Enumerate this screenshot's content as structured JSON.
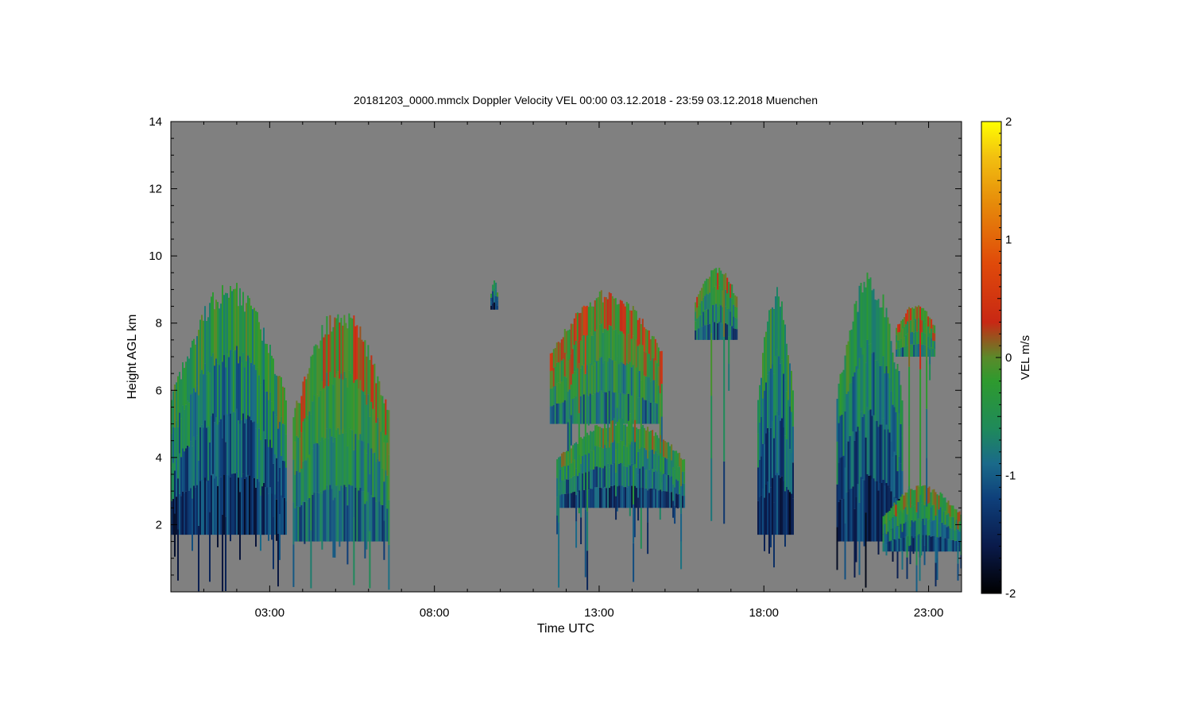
{
  "chart_data": {
    "type": "heatmap",
    "title": "20181203_0000.mmclx Doppler Velocity VEL   00:00 03.12.2018 - 23:59 03.12.2018 Muenchen",
    "xlabel": "Time UTC",
    "ylabel": "Height AGL km",
    "xlim": [
      0,
      24
    ],
    "ylim": [
      0,
      14
    ],
    "x_ticks": [
      {
        "value": 3,
        "label": "03:00"
      },
      {
        "value": 8,
        "label": "08:00"
      },
      {
        "value": 13,
        "label": "13:00"
      },
      {
        "value": 18,
        "label": "18:00"
      },
      {
        "value": 23,
        "label": "23:00"
      }
    ],
    "y_ticks": [
      {
        "value": 2,
        "label": "2"
      },
      {
        "value": 4,
        "label": "4"
      },
      {
        "value": 6,
        "label": "6"
      },
      {
        "value": 8,
        "label": "8"
      },
      {
        "value": 10,
        "label": "10"
      },
      {
        "value": 12,
        "label": "12"
      },
      {
        "value": 14,
        "label": "14"
      }
    ],
    "background_color": "#808080",
    "colorbar": {
      "label": "VEL m/s",
      "range": [
        -2,
        2
      ],
      "ticks": [
        {
          "value": 2,
          "label": "2"
        },
        {
          "value": 1,
          "label": "1"
        },
        {
          "value": 0,
          "label": "0"
        },
        {
          "value": -1,
          "label": "-1"
        },
        {
          "value": -2,
          "label": "-2"
        }
      ],
      "colormap": [
        {
          "value": -2.0,
          "color": "#000000"
        },
        {
          "value": -1.6,
          "color": "#0a1a4a"
        },
        {
          "value": -1.2,
          "color": "#0e3f7a"
        },
        {
          "value": -0.9,
          "color": "#1a6a8a"
        },
        {
          "value": -0.6,
          "color": "#1f8a5a"
        },
        {
          "value": -0.2,
          "color": "#2e9a2e"
        },
        {
          "value": 0.0,
          "color": "#5a8a2a"
        },
        {
          "value": 0.3,
          "color": "#c82814"
        },
        {
          "value": 0.8,
          "color": "#e04a0a"
        },
        {
          "value": 1.3,
          "color": "#e68a0a"
        },
        {
          "value": 1.7,
          "color": "#f2c010"
        },
        {
          "value": 2.0,
          "color": "#ffff00"
        }
      ]
    },
    "cloud_regions": [
      {
        "t_start": 0.0,
        "t_end": 3.5,
        "base_km": 1.7,
        "top_km": 9.3,
        "mean_vel": -0.8
      },
      {
        "t_start": 3.7,
        "t_end": 6.6,
        "base_km": 1.5,
        "top_km": 8.6,
        "mean_vel": -0.4
      },
      {
        "t_start": 9.7,
        "t_end": 9.9,
        "base_km": 8.4,
        "top_km": 9.3,
        "mean_vel": -0.9
      },
      {
        "t_start": 11.5,
        "t_end": 14.9,
        "base_km": 5.0,
        "top_km": 9.0,
        "mean_vel": -0.3
      },
      {
        "t_start": 11.7,
        "t_end": 15.6,
        "base_km": 2.5,
        "top_km": 5.2,
        "mean_vel": -0.7
      },
      {
        "t_start": 15.9,
        "t_end": 17.2,
        "base_km": 7.5,
        "top_km": 9.7,
        "mean_vel": -0.5
      },
      {
        "t_start": 17.8,
        "t_end": 18.9,
        "base_km": 1.7,
        "top_km": 9.2,
        "mean_vel": -0.9
      },
      {
        "t_start": 20.2,
        "t_end": 22.2,
        "base_km": 1.5,
        "top_km": 9.6,
        "mean_vel": -0.9
      },
      {
        "t_start": 21.6,
        "t_end": 24.0,
        "base_km": 1.2,
        "top_km": 3.2,
        "mean_vel": -0.6
      },
      {
        "t_start": 22.0,
        "t_end": 23.2,
        "base_km": 7.0,
        "top_km": 8.6,
        "mean_vel": -0.3
      }
    ]
  }
}
